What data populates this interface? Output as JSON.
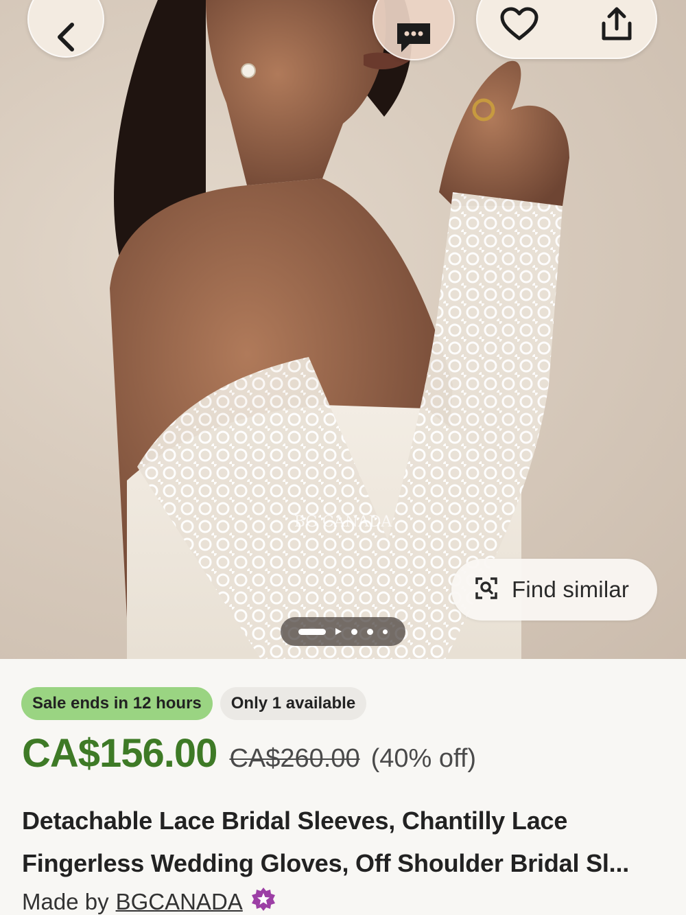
{
  "header": {
    "back_icon": "chevron-left-icon",
    "message_icon": "chat-bubble-icon",
    "favorite_icon": "heart-outline-icon",
    "share_icon": "share-icon"
  },
  "gallery": {
    "watermark": "BG CANADA",
    "find_similar_label": "Find similar",
    "find_similar_icon": "image-search-icon",
    "indicator_count": 5,
    "indicator_active": 0
  },
  "listing": {
    "badges": {
      "sale": "Sale ends in 12 hours",
      "stock": "Only 1 available"
    },
    "price": {
      "current": "CA$156.00",
      "original": "CA$260.00",
      "discount": "(40% off)"
    },
    "title_line1": "Detachable Lace Bridal Sleeves, Chantilly Lace",
    "title_line2": "Fingerless Wedding Gloves, Off Shoulder Bridal Sl...",
    "made_by_prefix": "Made by",
    "shop_name": "BGCANADA",
    "star_seller_icon": "star-seller-badge-icon"
  },
  "colors": {
    "sale_badge": "#9ad482",
    "price_green": "#3e7a26",
    "star_seller": "#9c3fa5"
  }
}
